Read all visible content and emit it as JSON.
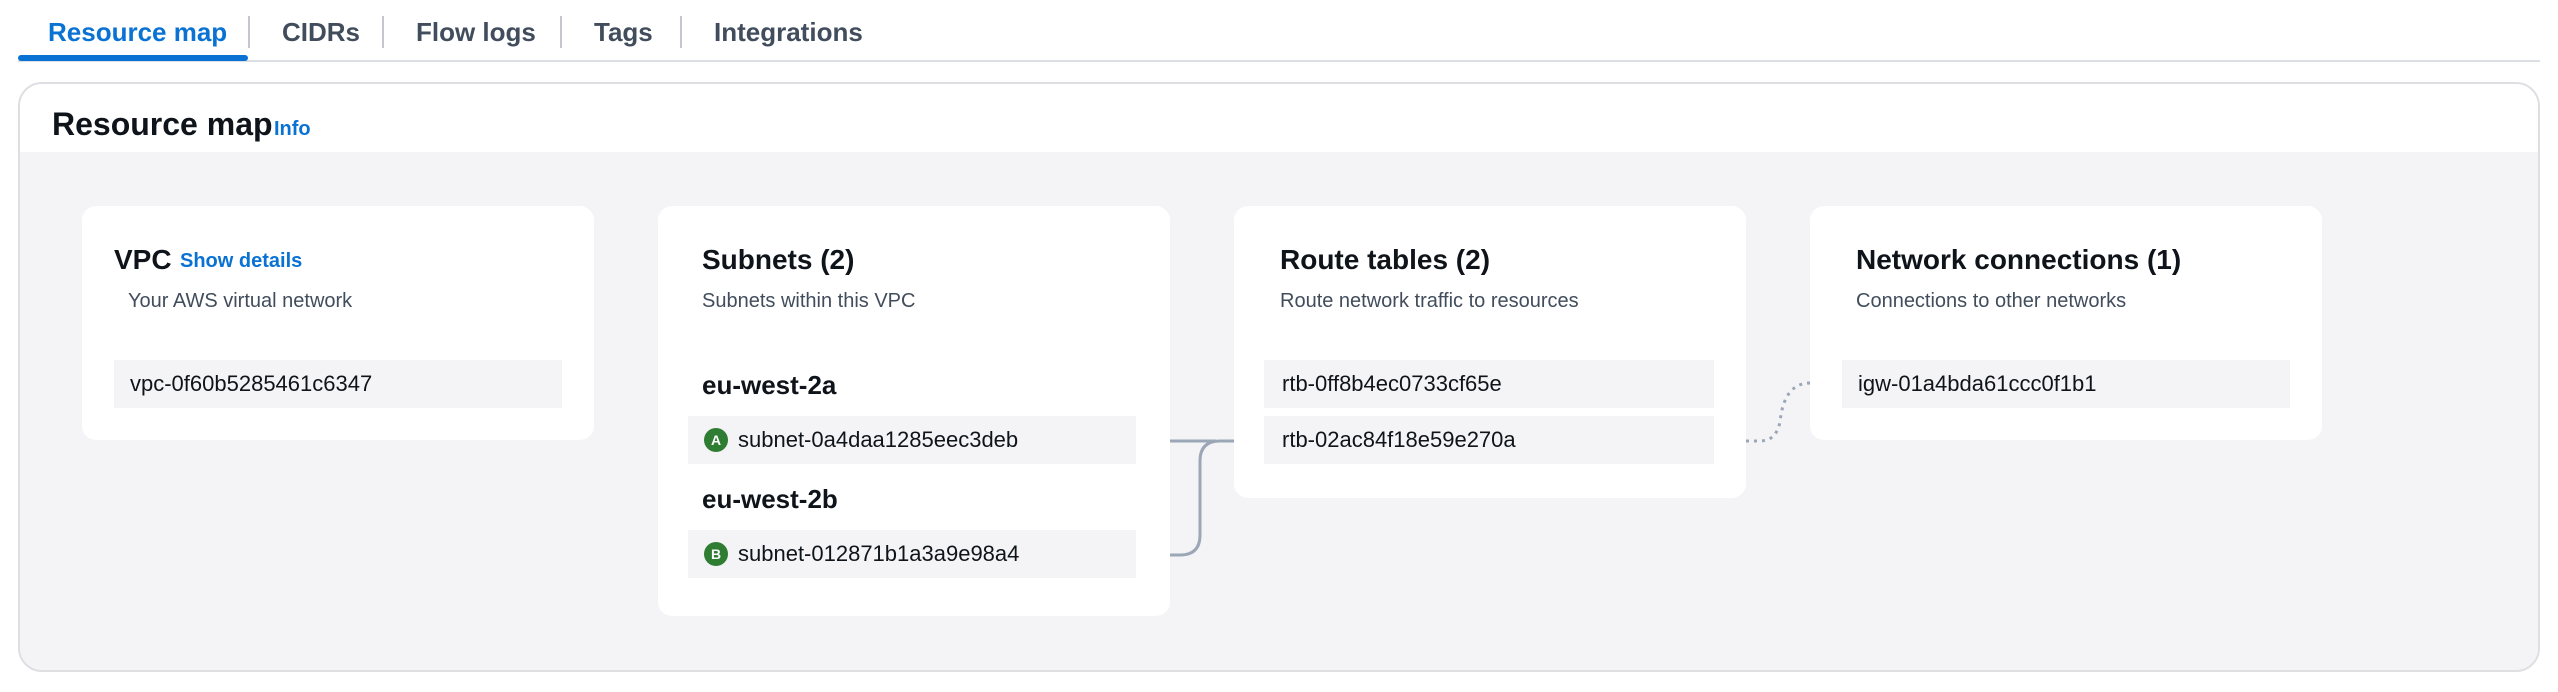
{
  "tabs": [
    {
      "label": "Resource map",
      "active": true
    },
    {
      "label": "CIDRs",
      "active": false
    },
    {
      "label": "Flow logs",
      "active": false
    },
    {
      "label": "Tags",
      "active": false
    },
    {
      "label": "Integrations",
      "active": false
    }
  ],
  "section": {
    "title": "Resource map",
    "info_label": "Info"
  },
  "vpc": {
    "title": "VPC",
    "details_link": "Show details",
    "subtitle": "Your AWS virtual network",
    "id": "vpc-0f60b5285461c6347"
  },
  "subnets": {
    "title": "Subnets (2)",
    "subtitle": "Subnets within this VPC",
    "zones": [
      {
        "name": "eu-west-2a",
        "badge": "A",
        "subnet": "subnet-0a4daa1285eec3deb"
      },
      {
        "name": "eu-west-2b",
        "badge": "B",
        "subnet": "subnet-012871b1a3a9e98a4"
      }
    ]
  },
  "route_tables": {
    "title": "Route tables (2)",
    "subtitle": "Route network traffic to resources",
    "items": [
      "rtb-0ff8b4ec0733cf65e",
      "rtb-02ac84f18e59e270a"
    ]
  },
  "network_connections": {
    "title": "Network connections (1)",
    "subtitle": "Connections to other networks",
    "items": [
      "igw-01a4bda61ccc0f1b1"
    ]
  },
  "colors": {
    "accent": "#0972d3",
    "az_badge": "#2e7d32",
    "connector": "#9ba7b6"
  }
}
